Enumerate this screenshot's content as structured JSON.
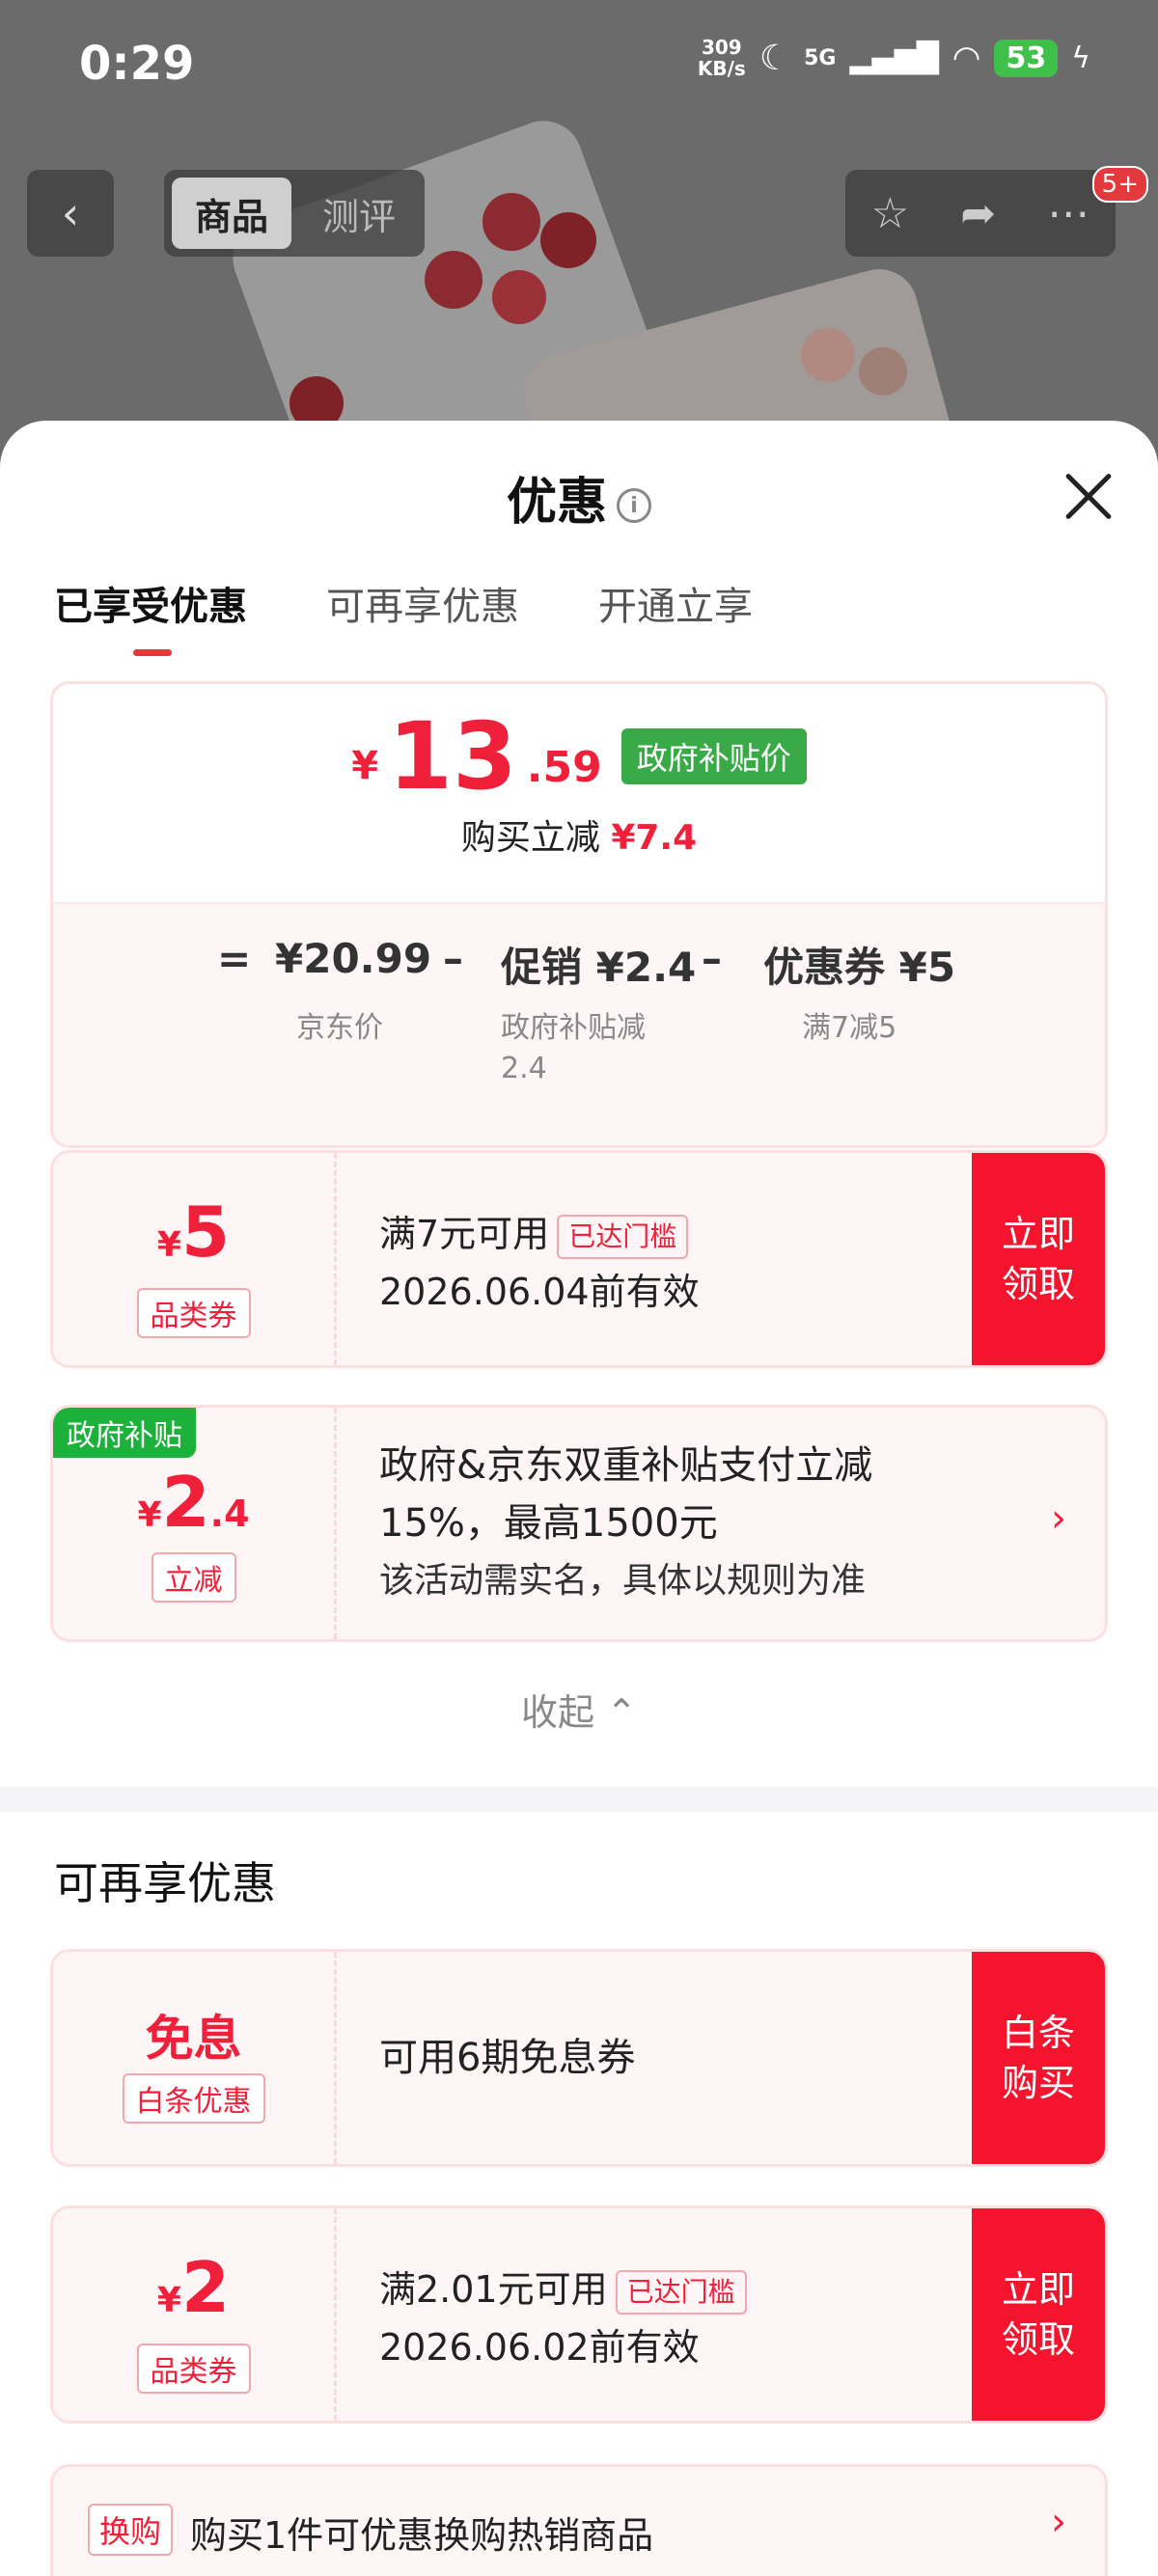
{
  "status": {
    "time": "0:29",
    "speed_top": "309",
    "speed_bot": "KB/s",
    "net": "5G",
    "battery": "53"
  },
  "nav": {
    "tab_goods": "商品",
    "tab_review": "测评",
    "badge": "5+"
  },
  "sheet": {
    "title": "优惠",
    "tabs": [
      "已享受优惠",
      "可再享优惠",
      "开通立享"
    ]
  },
  "summary": {
    "yen": "¥",
    "price_int": "13",
    "price_dec": ".59",
    "tag": "政府补贴价",
    "reduce_label": "购买立减",
    "reduce_value": "¥7.4",
    "eq": "=",
    "jd_price": "¥20.99",
    "minus": "–",
    "promo": "促销 ¥2.4",
    "coupon": "优惠券 ¥5",
    "jd_label": "京东价",
    "promo_sub": "政府补贴减\n2.4",
    "coupon_sub": "满7减5"
  },
  "coupons": [
    {
      "yen": "¥",
      "amount": "5",
      "dec": "",
      "type": "品类券",
      "line1": "满7元可用",
      "tag": "已达门槛",
      "line2": "2026.06.04前有效",
      "btn": "立即\n领取"
    },
    {
      "corner": "政府补贴",
      "yen": "¥",
      "amount": "2",
      "dec": ".4",
      "type": "立减",
      "line1": "政府&京东双重补贴支付立减",
      "line2": "15%，最高1500元",
      "line3": "该活动需实名，具体以规则为准",
      "arrow": "›"
    }
  ],
  "collapse": "收起 ⌃",
  "more_title": "可再享优惠",
  "more": [
    {
      "amount": "免息",
      "type": "白条优惠",
      "line1": "可用6期免息券",
      "btn": "白条\n购买"
    },
    {
      "yen": "¥",
      "amount": "2",
      "type": "品类券",
      "line1": "满2.01元可用",
      "tag": "已达门槛",
      "line2": "2026.06.02前有效",
      "btn": "立即\n领取"
    },
    {
      "tag": "换购",
      "line1": "购买1件可优惠换购热销商品",
      "arrow": "›"
    }
  ]
}
